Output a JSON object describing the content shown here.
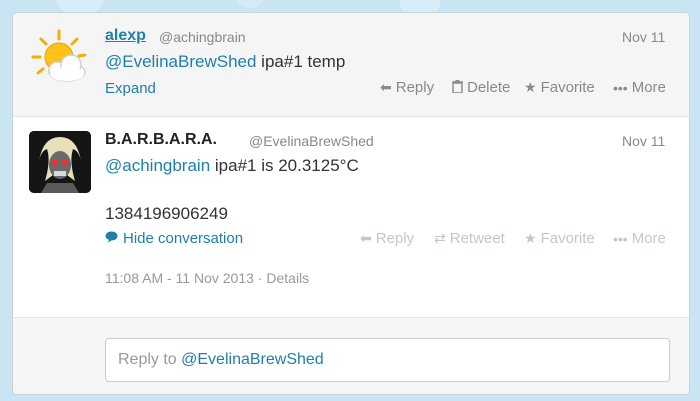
{
  "tweets": [
    {
      "name": "alexp",
      "handle": "@achingbrain",
      "date": "Nov 11",
      "mention": "@EvelinaBrewShed",
      "text": " ipa#1 temp",
      "expand_label": "Expand",
      "actions": {
        "reply": "Reply",
        "delete": "Delete",
        "favorite": "Favorite",
        "more": "More"
      }
    },
    {
      "name": "B.A.R.B.A.R.A.",
      "handle": "@EvelinaBrewShed",
      "date": "Nov 11",
      "mention": "@achingbrain",
      "text": " ipa#1 is 20.3125°C",
      "text2": "1384196906249",
      "hide_label": "Hide conversation",
      "actions": {
        "reply": "Reply",
        "retweet": "Retweet",
        "favorite": "Favorite",
        "more": "More"
      },
      "timestamp": "11:08 AM - 11 Nov 2013",
      "details": "Details"
    }
  ],
  "reply": {
    "prefix": "Reply to ",
    "target": "@EvelinaBrewShed"
  },
  "colors": {
    "link": "#1e7fab",
    "background": "#c9e4f2"
  },
  "icons": [
    "sun-cloud-avatar",
    "reply-arrow-icon",
    "trash-icon",
    "star-icon",
    "dots-icon",
    "speech-bubble-icon",
    "retweet-icon"
  ]
}
